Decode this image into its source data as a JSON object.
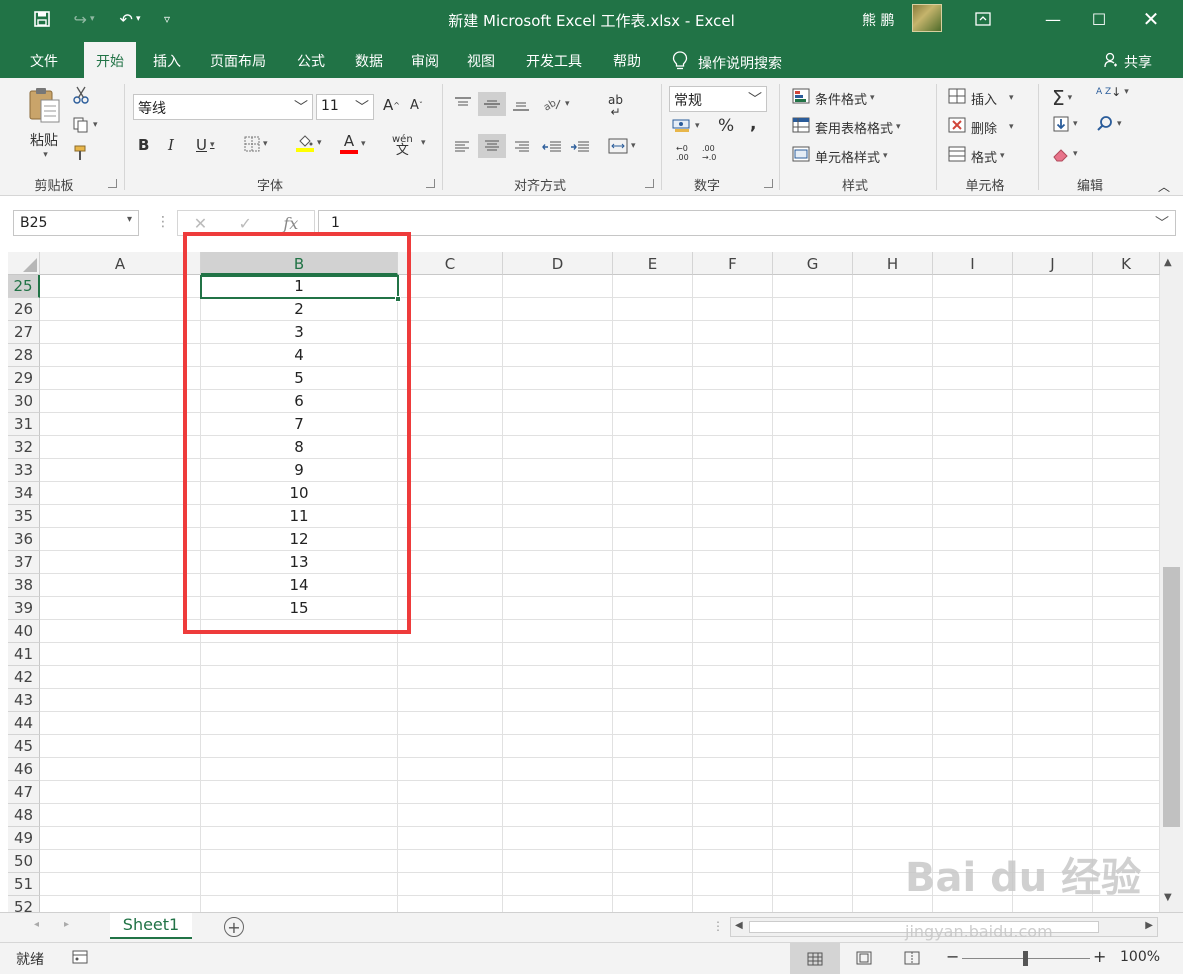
{
  "window": {
    "title": "新建 Microsoft Excel 工作表.xlsx - Excel",
    "user": "熊 鹏"
  },
  "tabs": [
    "文件",
    "开始",
    "插入",
    "页面布局",
    "公式",
    "数据",
    "审阅",
    "视图",
    "开发工具",
    "帮助"
  ],
  "active_tab": "开始",
  "tell_me": "操作说明搜索",
  "share": "共享",
  "ribbon": {
    "clipboard": {
      "paste": "粘贴",
      "label": "剪贴板"
    },
    "font": {
      "name": "等线",
      "size": "11",
      "bold": "B",
      "italic": "I",
      "underline": "U",
      "grow": "A",
      "shrink": "A",
      "pinyin": "wén",
      "font_color_letter": "A",
      "label": "字体"
    },
    "alignment": {
      "label": "对齐方式",
      "wrap": "ab"
    },
    "number": {
      "format": "常规",
      "percent": "%",
      "comma": ",",
      "label": "数字",
      "inc": "←0\n.00",
      "dec": ".00\n→.0"
    },
    "styles": {
      "conditional": "条件格式",
      "table": "套用表格格式",
      "cell": "单元格样式",
      "label": "样式"
    },
    "cells": {
      "insert": "插入",
      "delete": "删除",
      "format": "格式",
      "label": "单元格"
    },
    "editing": {
      "label": "编辑",
      "sum": "Σ",
      "sort": "A Z"
    }
  },
  "formula_bar": {
    "name_box": "B25",
    "fx": "fx",
    "value": "1"
  },
  "grid": {
    "columns": [
      "A",
      "B",
      "C",
      "D",
      "E",
      "F",
      "G",
      "H",
      "I",
      "J",
      "K"
    ],
    "selected_column": "B",
    "rows": [
      "25",
      "26",
      "27",
      "28",
      "29",
      "30",
      "31",
      "32",
      "33",
      "34",
      "35",
      "36",
      "37",
      "38",
      "39",
      "40",
      "41",
      "42",
      "43",
      "44",
      "45",
      "46",
      "47",
      "48",
      "49",
      "50",
      "51",
      "52"
    ],
    "selected_row": "25",
    "b_values": [
      "1",
      "2",
      "3",
      "4",
      "5",
      "6",
      "7",
      "8",
      "9",
      "10",
      "11",
      "12",
      "13",
      "14",
      "15"
    ]
  },
  "sheets": [
    "Sheet1"
  ],
  "status": {
    "ready": "就绪",
    "zoom": "100%"
  },
  "watermark": {
    "main": "Bai du 经验",
    "sub": "jingyan.baidu.com"
  },
  "colors": {
    "excel_green": "#217346",
    "highlight_red": "#ee3b3b"
  }
}
